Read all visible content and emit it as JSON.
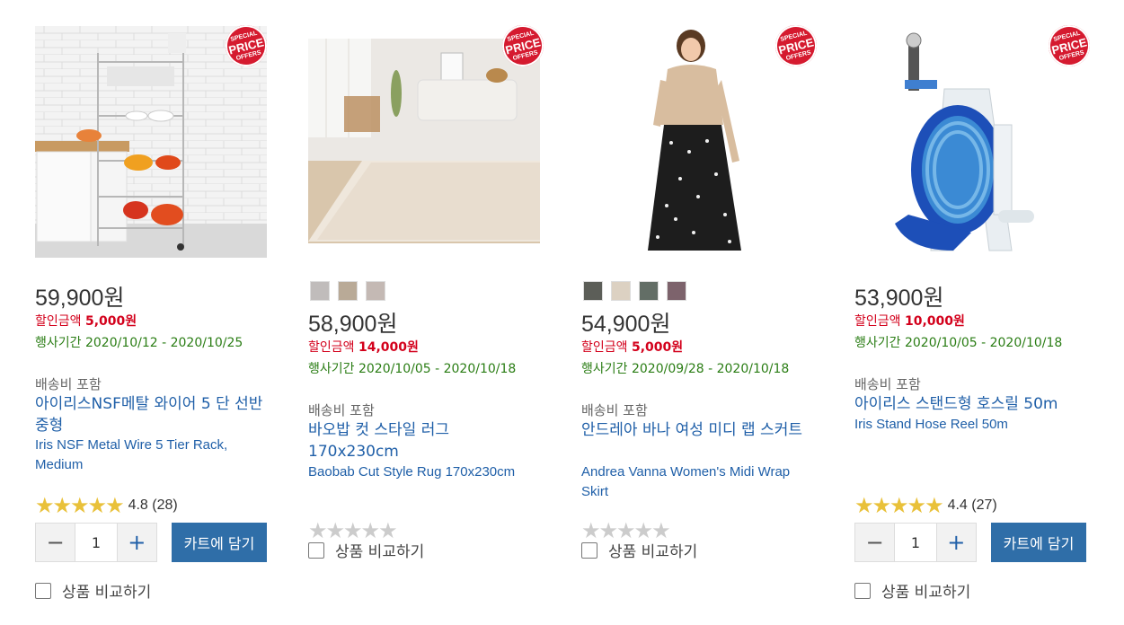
{
  "badge": {
    "line1": "SPECIAL",
    "line2": "PRICE",
    "line3": "OFFERS"
  },
  "colors": {
    "accent": "#2f6ea8",
    "discount": "#d3001b",
    "period": "#2a7d14",
    "star": "#e9c13a",
    "badge": "#d51a2f"
  },
  "products": [
    {
      "price": "59,900원",
      "discount_label": "할인금액",
      "discount_value": "5,000원",
      "period": "행사기간 2020/10/12 - 2020/10/25",
      "shipping": "배송비 포함",
      "name_ko": "아이리스NSF메탈 와이어  5 단 선반 중형",
      "name_en": "Iris NSF Metal Wire 5 Tier Rack, Medium",
      "stars": "★★★★★",
      "rating": "4.8 (28)",
      "qty": "1",
      "minus": "−",
      "plus": "+",
      "cart": "카트에 담기",
      "compare": "상품 비교하기"
    },
    {
      "swatches": [
        "#c0bcbb",
        "#b9aa97",
        "#c4b9b4"
      ],
      "price": "58,900원",
      "discount_label": "할인금액",
      "discount_value": "14,000원",
      "period": "행사기간 2020/10/05 - 2020/10/18",
      "shipping": "배송비 포함",
      "name_ko": "바오밥 컷 스타일 러그 170x230cm",
      "name_en": "Baobab Cut Style Rug 170x230cm",
      "stars": "★★★★★",
      "compare": "상품 비교하기"
    },
    {
      "swatches": [
        "#5c5e58",
        "#dcd1c2",
        "#636e66",
        "#7d636c"
      ],
      "price": "54,900원",
      "discount_label": "할인금액",
      "discount_value": "5,000원",
      "period": "행사기간 2020/09/28 - 2020/10/18",
      "shipping": "배송비 포함",
      "name_ko": "안드레아 바나 여성 미디 랩 스커트",
      "name_en": "Andrea Vanna Women's Midi Wrap Skirt",
      "stars": "★★★★★",
      "compare": "상품 비교하기"
    },
    {
      "price": "53,900원",
      "discount_label": "할인금액",
      "discount_value": "10,000원",
      "period": "행사기간 2020/10/05 - 2020/10/18",
      "shipping": "배송비 포함",
      "name_ko": "아이리스 스탠드형 호스릴 50m",
      "name_en": "Iris Stand Hose Reel 50m",
      "stars": "★★★★★",
      "rating": "4.4 (27)",
      "qty": "1",
      "minus": "−",
      "plus": "+",
      "cart": "카트에 담기",
      "compare": "상품 비교하기"
    }
  ]
}
